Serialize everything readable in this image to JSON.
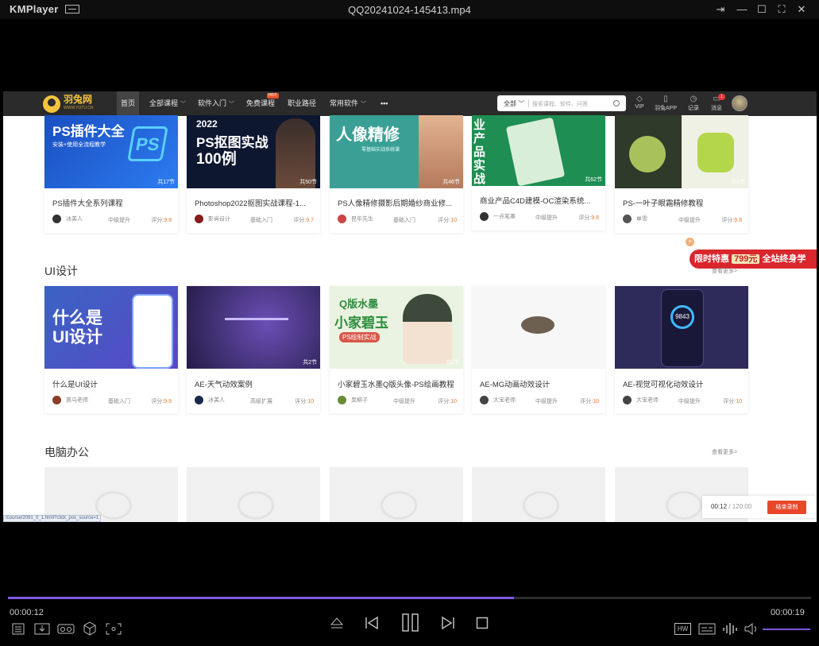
{
  "app": {
    "name": "KMPlayer",
    "file_title": "QQ20241024-145413.mp4"
  },
  "site": {
    "brand": "羽兔网",
    "brand_sub": "WWW.YUTU.CN",
    "nav": [
      "首页",
      "全部课程",
      "软件入门",
      "免费课程",
      "职业路径",
      "常用软件",
      "•••"
    ],
    "hot_badge": "HOT",
    "search_scope": "全部",
    "search_placeholder": "搜索课程、软件、问答",
    "top_icons": [
      "VIP",
      "羽兔APP",
      "记录",
      "消息"
    ],
    "message_badge": "1"
  },
  "row1": [
    {
      "title": "PS插件大全系列课程",
      "author": "冰美人",
      "level": "中级提升",
      "score_label": "评分:",
      "score": "9.9",
      "lessons": "共17节",
      "thumb_text": "PS插件大全",
      "thumb_sub": "安装+使用全流程教学",
      "thumb_color": "#1f66d8"
    },
    {
      "title": "Photoshop2022抠图实战课程-1...",
      "author": "影尚设计",
      "level": "基础入门",
      "score_label": "评分:",
      "score": "9.7",
      "lessons": "共50节",
      "thumb_text": "PS抠图实战",
      "thumb_sub": "100例",
      "thumb_year": "2022",
      "thumb_color": "#0e1730"
    },
    {
      "title": "PS人像精修摄影后期婚纱商业修...",
      "author": "昆年先生",
      "level": "基础入门",
      "score_label": "评分:",
      "score": "10",
      "lessons": "共46节",
      "thumb_text": "人像精修",
      "thumb_sub": "零基础实战系统课",
      "thumb_color": "#3aa095"
    },
    {
      "title": "商业产品C4D建模-OC渲染系统...",
      "author": "一点笔墨",
      "level": "中级提升",
      "score_label": "评分:",
      "score": "9.8",
      "lessons": "共62节",
      "thumb_text": "业产品实战",
      "thumb_color": "#1e8e52"
    },
    {
      "title": "PS-一叶子眼霜精修教程",
      "author": "单雪",
      "level": "中级提升",
      "score_label": "评分:",
      "score": "9.8",
      "lessons": "共6节",
      "thumb_color": "#eef1e4"
    }
  ],
  "section_ui": {
    "title": "UI设计",
    "more": "查看更多>"
  },
  "row2": [
    {
      "title": "什么是UI设计",
      "author": "黑马老师",
      "level": "基础入门",
      "score_label": "评分:",
      "score": "9.9",
      "thumb_text": "什么是",
      "thumb_sub": "UI设计",
      "thumb_color": "#3a63c4"
    },
    {
      "title": "AE-天气动效案例",
      "author": "冰美人",
      "level": "高级扩展",
      "score_label": "评分:",
      "score": "10",
      "lessons": "共2节",
      "thumb_color": "#2e2456"
    },
    {
      "title": "小家碧玉水墨Q版头像-PS绘画教程",
      "author": "吴柳子",
      "level": "中级提升",
      "score_label": "评分:",
      "score": "10",
      "lessons": "共1节",
      "thumb_text": "Q版水墨",
      "thumb_sub": "小家碧玉",
      "thumb_tag": "PS绘制实战",
      "thumb_color": "#eaf3e1"
    },
    {
      "title": "AE-MG动画动效设计",
      "author": "大宝老师",
      "level": "中级提升",
      "score_label": "评分:",
      "score": "10",
      "thumb_color": "#f7f7f7"
    },
    {
      "title": "AE-视觉可视化动效设计",
      "author": "大宝老师",
      "level": "中级提升",
      "score_label": "评分:",
      "score": "10",
      "thumb_value": "9843",
      "thumb_color": "#2e2a5a"
    }
  ],
  "section_office": {
    "title": "电脑办公",
    "more": "查看更多>"
  },
  "promo": {
    "pre": "限时特惠",
    "price": "799元",
    "post": "全站终身学"
  },
  "recording": {
    "current": "00:12",
    "total": "/ 120:00",
    "stop": "结束录制"
  },
  "status_url": "/course/2091_0_1.html?click_pos_source=1",
  "player": {
    "elapsed": "00:00:12",
    "duration": "00:00:19",
    "progress": 0.63,
    "volume": 1.0,
    "hw_label": "HW"
  }
}
